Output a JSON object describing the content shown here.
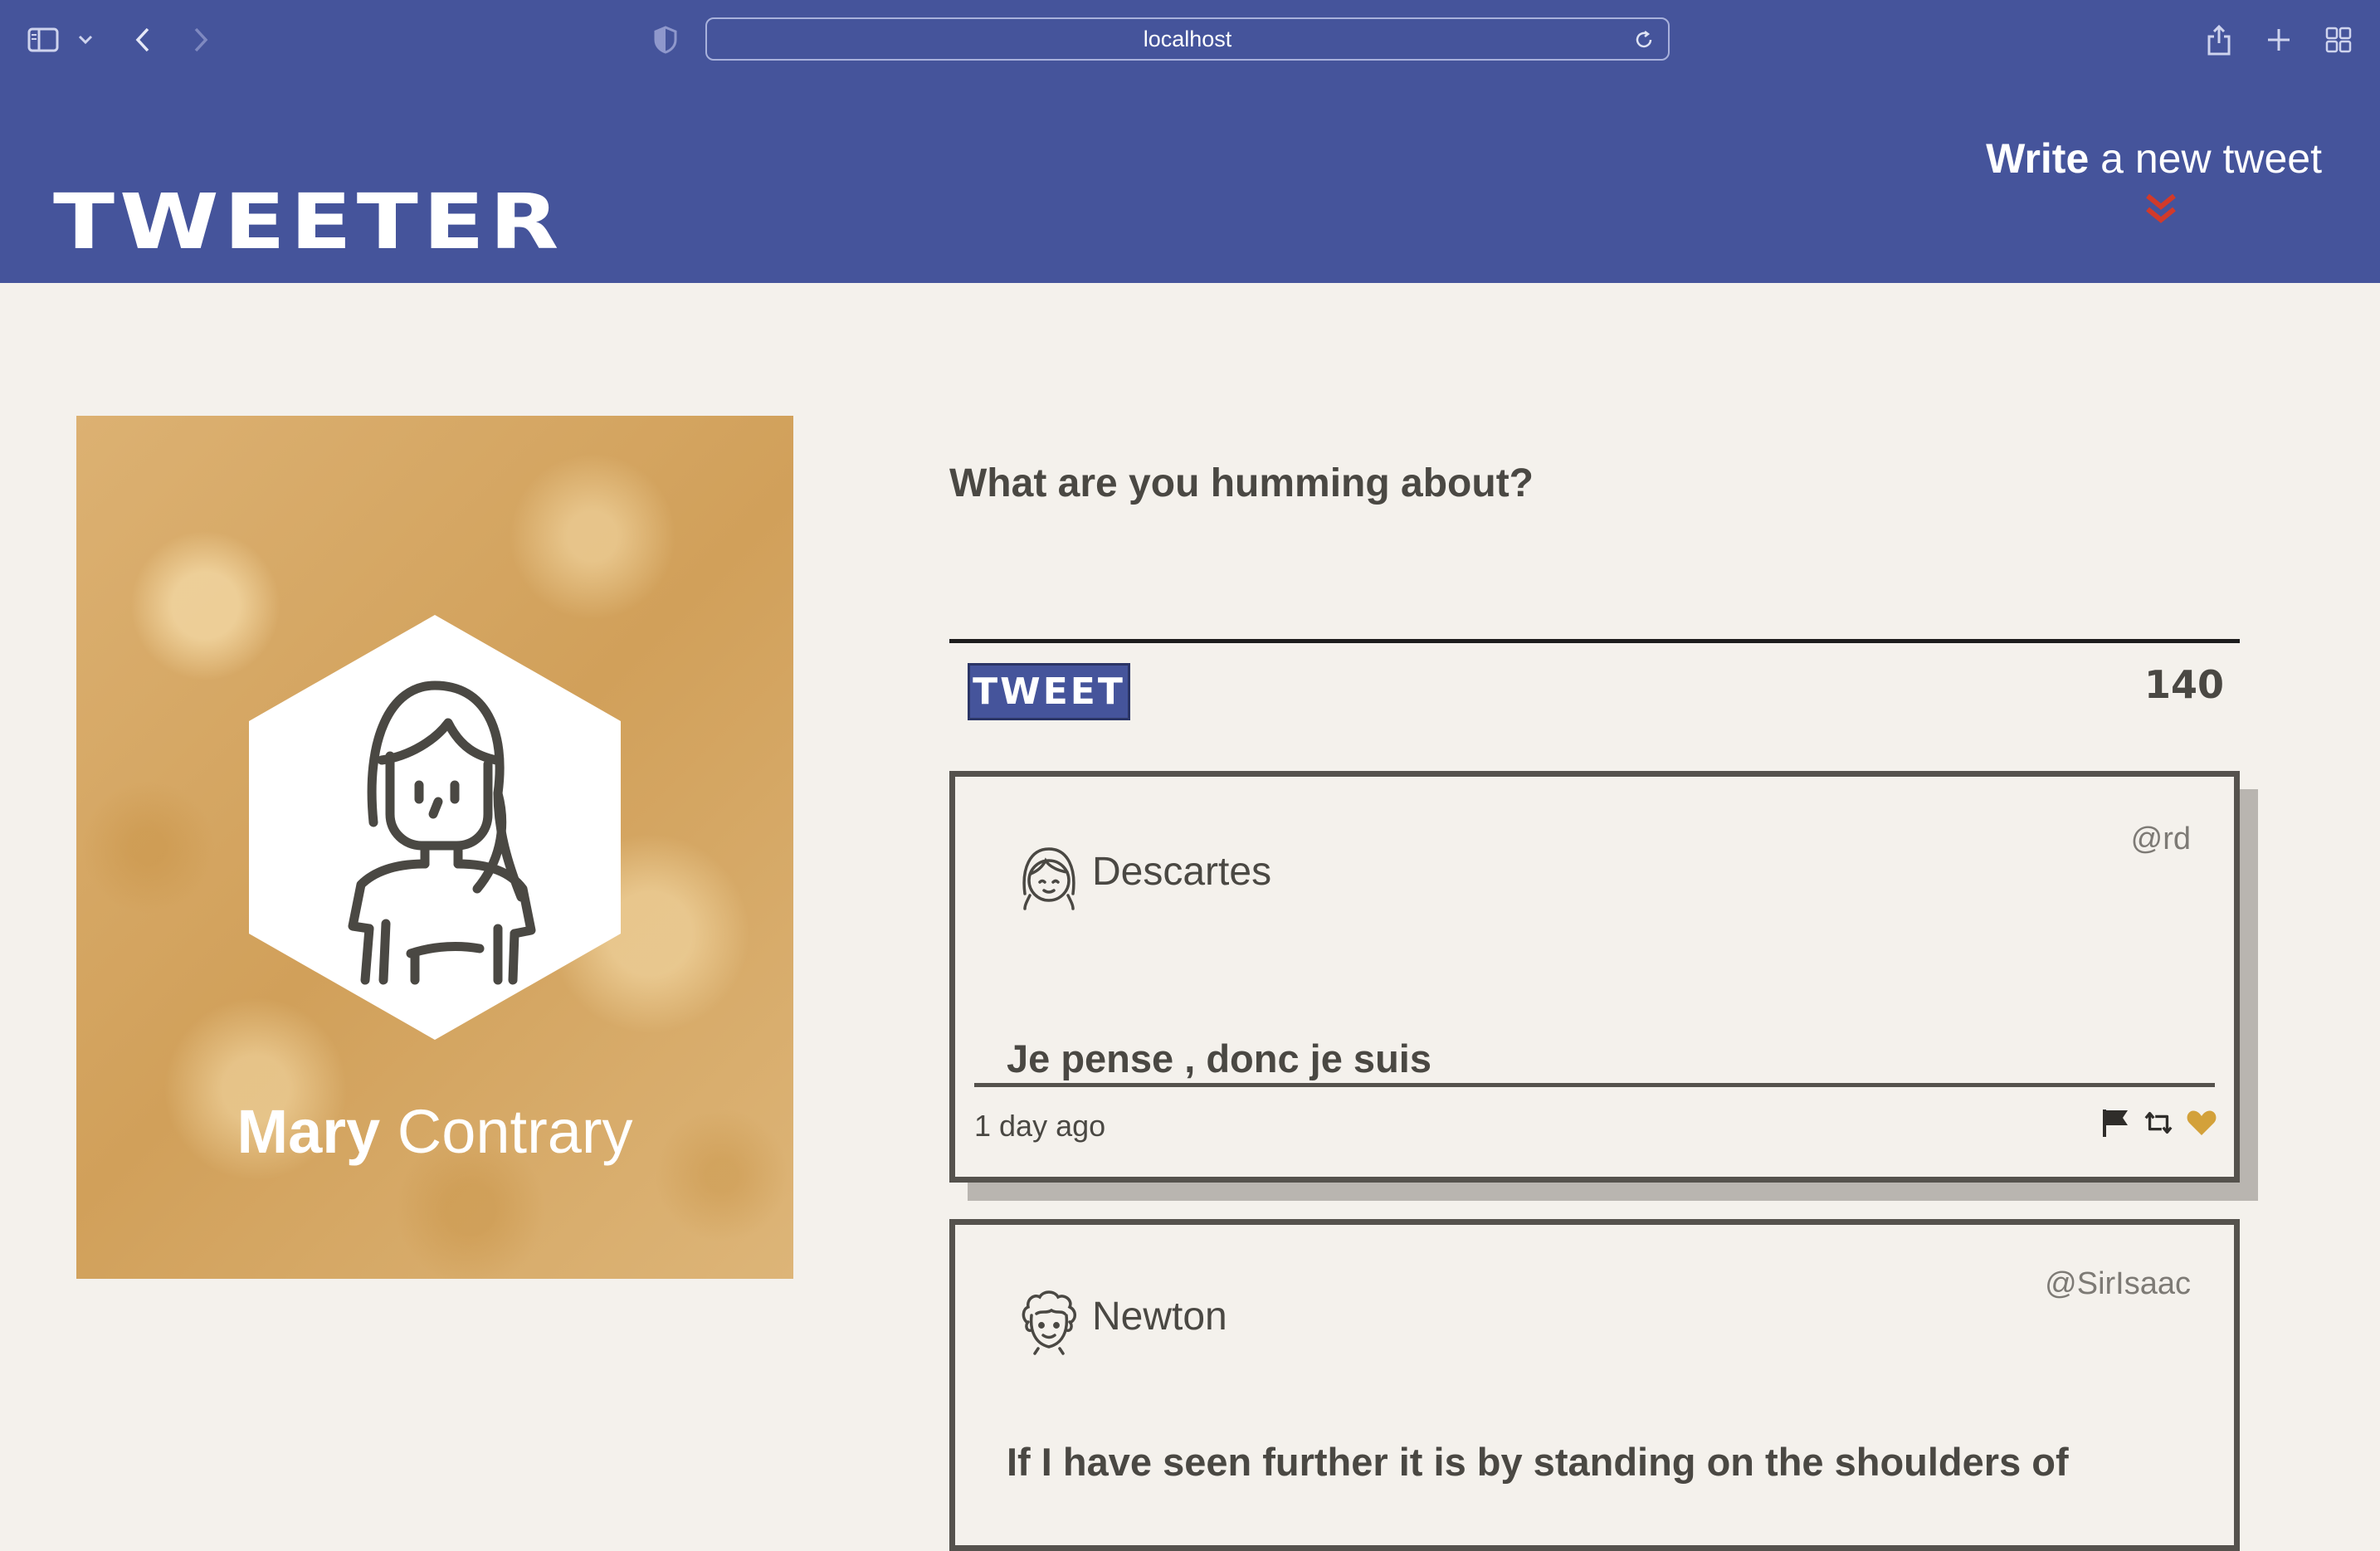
{
  "browser": {
    "url": "localhost",
    "icons": [
      "sidebar-icon",
      "chevron-down-icon",
      "back-arrow-icon",
      "forward-arrow-icon",
      "shield-icon",
      "reload-icon",
      "share-icon",
      "plus-icon",
      "tab-grid-icon"
    ]
  },
  "header": {
    "logo": "TWEETER",
    "write_bold": "Write",
    "write_rest": " a new tweet",
    "chevron_color": "#d23a2a"
  },
  "profile": {
    "first_name": "Mary",
    "last_name": " Contrary",
    "avatar": "woman-avatar-icon"
  },
  "compose": {
    "prompt": "What are you humming about?",
    "button_label": "TWEET",
    "counter": "140"
  },
  "tweets": [
    {
      "name": "Descartes",
      "handle": "@rd",
      "text": "Je pense , donc je suis",
      "time": "1 day ago",
      "avatar": "girl-avatar-icon"
    },
    {
      "name": "Newton",
      "handle": "@SirIsaac",
      "text": "If I have seen further it is by standing on the shoulders of",
      "avatar": "curly-hair-avatar-icon"
    }
  ],
  "colors": {
    "brand": "#45549b",
    "background": "#f4f1ec",
    "text": "#4a4843",
    "like": "#d3a13a"
  }
}
